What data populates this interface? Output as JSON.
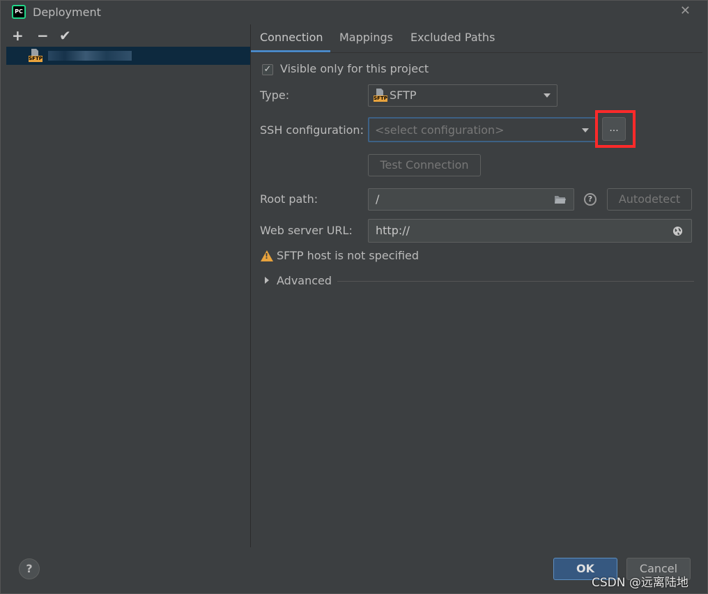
{
  "window": {
    "title": "Deployment",
    "app_icon_text": "PC",
    "close_glyph": "✕"
  },
  "left_toolbar": {
    "add": "+",
    "remove": "−",
    "apply": "✔"
  },
  "server_list": {
    "items": [
      {
        "icon": "sftp-server-icon",
        "icon_label": "SFTP",
        "name_redacted": true
      }
    ]
  },
  "tabs": [
    {
      "label": "Connection",
      "active": true
    },
    {
      "label": "Mappings",
      "active": false
    },
    {
      "label": "Excluded Paths",
      "active": false
    }
  ],
  "connection": {
    "visible_only_label": "Visible only for this project",
    "visible_only_checked": true,
    "checkmark": "✓",
    "type_label": "Type:",
    "type_value": "SFTP",
    "type_icon_label": "SFTP",
    "ssh_label": "SSH configuration:",
    "ssh_placeholder": "<select configuration>",
    "ssh_browse": "...",
    "test_connection": "Test Connection",
    "root_path_label": "Root path:",
    "root_path_value": "/",
    "help_glyph": "?",
    "autodetect": "Autodetect",
    "web_url_label": "Web server URL:",
    "web_url_value": "http://",
    "warning_text": "SFTP host is not specified",
    "warning_glyph": "!",
    "advanced_label": "Advanced"
  },
  "footer": {
    "help_glyph": "?",
    "ok": "OK",
    "cancel": "Cancel"
  },
  "watermark": "CSDN @远离陆地",
  "colors": {
    "background": "#3c3f41",
    "selection": "#0d293e",
    "accent": "#4a88c7",
    "highlight_box": "#ff2a2a",
    "warning": "#e8a33d",
    "ok_button": "#365880"
  }
}
